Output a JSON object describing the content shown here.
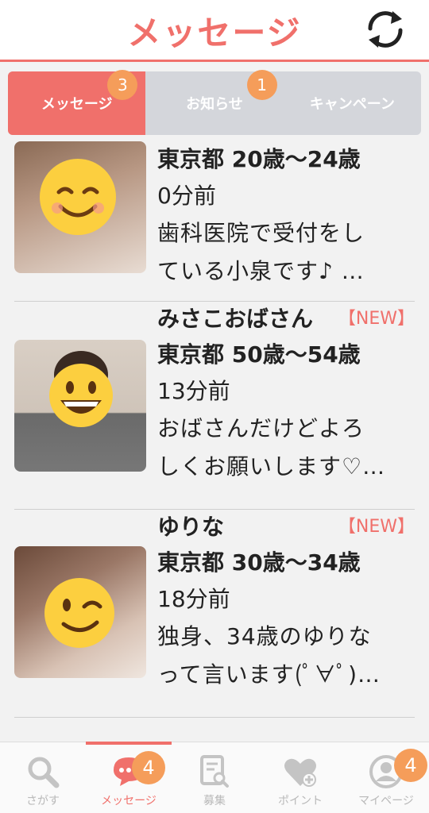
{
  "header": {
    "title": "メッセージ",
    "refresh_icon": "refresh-icon"
  },
  "tabs": [
    {
      "label": "メッセージ",
      "badge": "3",
      "active": true
    },
    {
      "label": "お知らせ",
      "badge": "1",
      "active": false
    },
    {
      "label": "キャンペーン",
      "badge": "",
      "active": false
    }
  ],
  "messages": [
    {
      "name": "",
      "new_tag": "",
      "location_age": "東京都 20歳〜24歳",
      "time": "0分前",
      "preview_line1": "歯科医院で受付をし",
      "preview_line2": "ている小泉です♪ …",
      "avatar_icon": "smiling-face-icon"
    },
    {
      "name": "みさこおばさん",
      "new_tag": "【NEW】",
      "location_age": "東京都 50歳〜54歳",
      "time": "13分前",
      "preview_line1": "おばさんだけどよろ",
      "preview_line2": "しくお願いします♡…",
      "avatar_icon": "grinning-face-icon"
    },
    {
      "name": "ゆりな",
      "new_tag": "【NEW】",
      "location_age": "東京都 30歳〜34歳",
      "time": "18分前",
      "preview_line1": "独身、34歳のゆりな",
      "preview_line2": "って言います(ﾟ∀ﾟ)…",
      "avatar_icon": "winking-face-icon"
    }
  ],
  "bottom_nav": [
    {
      "label": "さがす",
      "icon": "search-icon",
      "badge": ""
    },
    {
      "label": "メッセージ",
      "icon": "chat-bubble-icon",
      "badge": "4",
      "active": true
    },
    {
      "label": "募集",
      "icon": "document-search-icon",
      "badge": ""
    },
    {
      "label": "ポイント",
      "icon": "heart-plus-icon",
      "badge": ""
    },
    {
      "label": "マイページ",
      "icon": "user-profile-icon",
      "badge": "4"
    }
  ],
  "colors": {
    "accent": "#f0706b",
    "badge": "#f59d5a",
    "tab_inactive": "#d4d6db"
  }
}
